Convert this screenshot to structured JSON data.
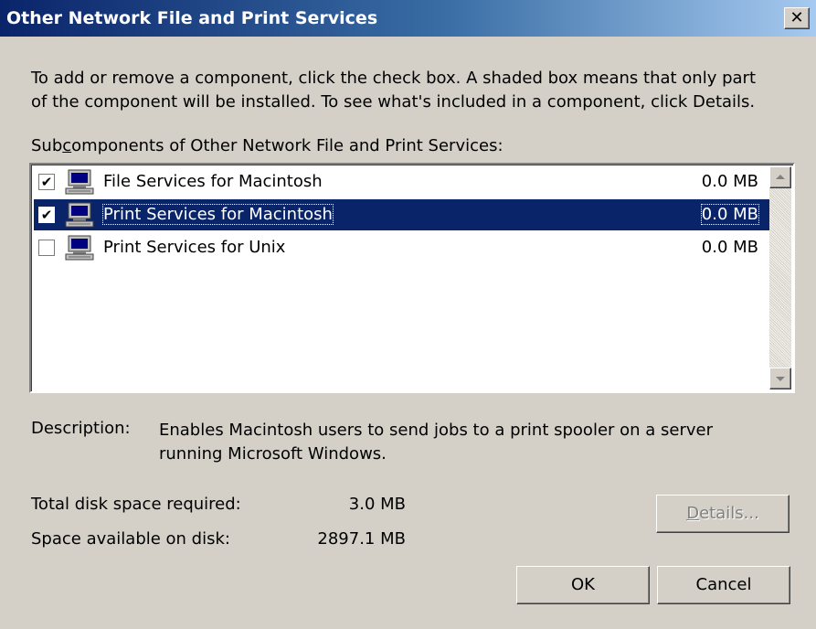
{
  "window": {
    "title": "Other Network File and Print Services",
    "close_glyph": "✕"
  },
  "instructions": {
    "line1": "To add or remove a component, click the check box. A shaded box means that only part",
    "line2": "of the component will be installed. To see what's included in a component, click Details."
  },
  "subcomponents_label": {
    "pre": "Sub",
    "accel": "c",
    "post": "omponents of Other Network File and Print Services:"
  },
  "components": [
    {
      "label": "File Services for Macintosh",
      "size": "0.0 MB",
      "checked": true,
      "selected": false,
      "check_glyph": "✔",
      "icon": "computer-icon"
    },
    {
      "label": "Print Services for Macintosh",
      "size": "0.0 MB",
      "checked": true,
      "selected": true,
      "check_glyph": "✔",
      "icon": "computer-icon"
    },
    {
      "label": "Print Services for Unix",
      "size": "0.0 MB",
      "checked": false,
      "selected": false,
      "check_glyph": "",
      "icon": "computer-icon"
    }
  ],
  "description": {
    "label": "Description:",
    "line1": "Enables Macintosh users to send jobs to a print spooler on a server",
    "line2": "running Microsoft Windows."
  },
  "disk": {
    "total_label": "Total disk space required:",
    "total_value": "3.0 MB",
    "available_label": "Space available on disk:",
    "available_value": "2897.1 MB"
  },
  "buttons": {
    "details": {
      "accel": "D",
      "rest": "etails...",
      "enabled": false
    },
    "ok": "OK",
    "cancel": "Cancel"
  },
  "colors": {
    "face": "#d4d0c8",
    "title_start": "#0a246a",
    "title_end": "#a6caf0",
    "selection": "#0a246a"
  }
}
